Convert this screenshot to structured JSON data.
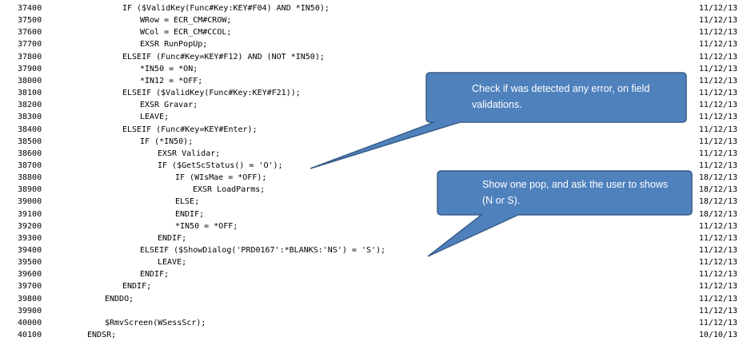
{
  "code_lines": [
    {
      "seq": "37400",
      "text": "IF ($ValidKey(Func#Key:KEY#F04) AND *IN50);",
      "indent": 0,
      "date": "11/12/13"
    },
    {
      "seq": "37500",
      "text": "WRow = ECR_CM#CROW;",
      "indent": 1,
      "date": "11/12/13"
    },
    {
      "seq": "37600",
      "text": "WCol = ECR_CM#CCOL;",
      "indent": 1,
      "date": "11/12/13"
    },
    {
      "seq": "37700",
      "text": "EXSR RunPopUp;",
      "indent": 1,
      "date": "11/12/13"
    },
    {
      "seq": "37800",
      "text": "ELSEIF (Func#Key=KEY#F12) AND (NOT *IN50);",
      "indent": 0,
      "date": "11/12/13"
    },
    {
      "seq": "37900",
      "text": "*IN50 = *ON;",
      "indent": 1,
      "date": "11/12/13"
    },
    {
      "seq": "38000",
      "text": "*IN12 = *OFF;",
      "indent": 1,
      "date": "11/12/13"
    },
    {
      "seq": "38100",
      "text": "ELSEIF ($ValidKey(Func#Key:KEY#F21));",
      "indent": 0,
      "date": "11/12/13"
    },
    {
      "seq": "38200",
      "text": "EXSR Gravar;",
      "indent": 1,
      "date": "11/12/13"
    },
    {
      "seq": "38300",
      "text": "LEAVE;",
      "indent": 1,
      "date": "11/12/13"
    },
    {
      "seq": "38400",
      "text": "ELSEIF (Func#Key=KEY#Enter);",
      "indent": 0,
      "date": "11/12/13"
    },
    {
      "seq": "38500",
      "text": "IF (*IN50);",
      "indent": 1,
      "date": "11/12/13"
    },
    {
      "seq": "38600",
      "text": "EXSR Validar;",
      "indent": 2,
      "date": "11/12/13"
    },
    {
      "seq": "38700",
      "text": "IF ($GetScStatus() = 'O');",
      "indent": 2,
      "date": "11/12/13"
    },
    {
      "seq": "38800",
      "text": "IF (WIsMae = *OFF);",
      "indent": 3,
      "date": "18/12/13"
    },
    {
      "seq": "38900",
      "text": "EXSR LoadParms;",
      "indent": 4,
      "date": "18/12/13"
    },
    {
      "seq": "39000",
      "text": "ELSE;",
      "indent": 3,
      "date": "18/12/13"
    },
    {
      "seq": "39100",
      "text": "ENDIF;",
      "indent": 3,
      "date": "18/12/13"
    },
    {
      "seq": "39200",
      "text": "*IN50 = *OFF;",
      "indent": 3,
      "date": "11/12/13"
    },
    {
      "seq": "39300",
      "text": "ENDIF;",
      "indent": 2,
      "date": "11/12/13"
    },
    {
      "seq": "39400",
      "text": "ELSEIF ($ShowDialog('PRD0167':*BLANKS:'NS') = 'S');",
      "indent": 1,
      "date": "11/12/13"
    },
    {
      "seq": "39500",
      "text": "LEAVE;",
      "indent": 2,
      "date": "11/12/13"
    },
    {
      "seq": "39600",
      "text": "ENDIF;",
      "indent": 1,
      "date": "11/12/13"
    },
    {
      "seq": "39700",
      "text": "ENDIF;",
      "indent": 0,
      "date": "11/12/13"
    },
    {
      "seq": "39800",
      "text": "ENDDO;",
      "indent": -1,
      "date": "11/12/13"
    },
    {
      "seq": "39900",
      "text": "",
      "indent": -1,
      "date": "11/12/13"
    },
    {
      "seq": "40000",
      "text": "$RmvScreen(WSessScr);",
      "indent": -1,
      "date": "11/12/13"
    },
    {
      "seq": "40100",
      "text": "ENDSR;",
      "indent": -2,
      "date": "10/10/13"
    }
  ],
  "callouts": {
    "error_check": {
      "text_line1": "Check if was detected any error, on field",
      "text_line2": "validations."
    },
    "show_dialog": {
      "text_line1": "Show one pop, and ask the user to shows",
      "text_line2": "(N or S)."
    }
  },
  "colors": {
    "callout_fill": "#4f81bd",
    "callout_border": "#385d8a",
    "code_text": "#000000",
    "squiggle": "#e03c31",
    "cursor_underline": "#1f4fff"
  }
}
